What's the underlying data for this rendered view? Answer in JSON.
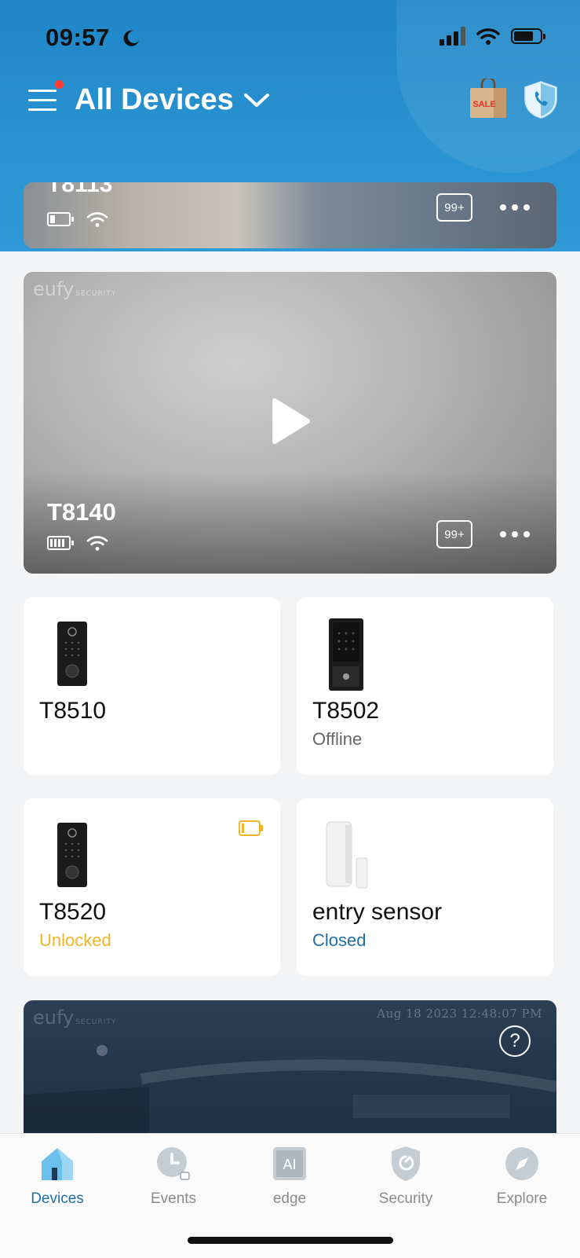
{
  "status_bar": {
    "time": "09:57"
  },
  "header": {
    "title": "All Devices",
    "sale_text": "SALE"
  },
  "cameras": [
    {
      "name": "T8113",
      "events_badge": "99+"
    },
    {
      "name": "T8140",
      "events_badge": "99+",
      "watermark": "eufy",
      "watermark_sub": "SECURITY"
    }
  ],
  "devices": [
    {
      "name": "T8510",
      "status": ""
    },
    {
      "name": "T8502",
      "status": "Offline"
    },
    {
      "name": "T8520",
      "status": "Unlocked"
    },
    {
      "name": "entry sensor",
      "status": "Closed"
    }
  ],
  "bottom_camera": {
    "watermark": "eufy",
    "watermark_sub": "SECURITY",
    "timestamp": "Aug 18 2023   12:48:07 PM",
    "help": "?"
  },
  "tabs": [
    {
      "label": "Devices",
      "active": true
    },
    {
      "label": "Events"
    },
    {
      "label": "edge",
      "icon_text": "AI"
    },
    {
      "label": "Security"
    },
    {
      "label": "Explore"
    }
  ],
  "colors": {
    "header_blue": "#2a93d1",
    "unlocked": "#f0b429",
    "closed": "#1e6fa6",
    "offline": "#666666",
    "tab_active": "#1e6fa6"
  }
}
